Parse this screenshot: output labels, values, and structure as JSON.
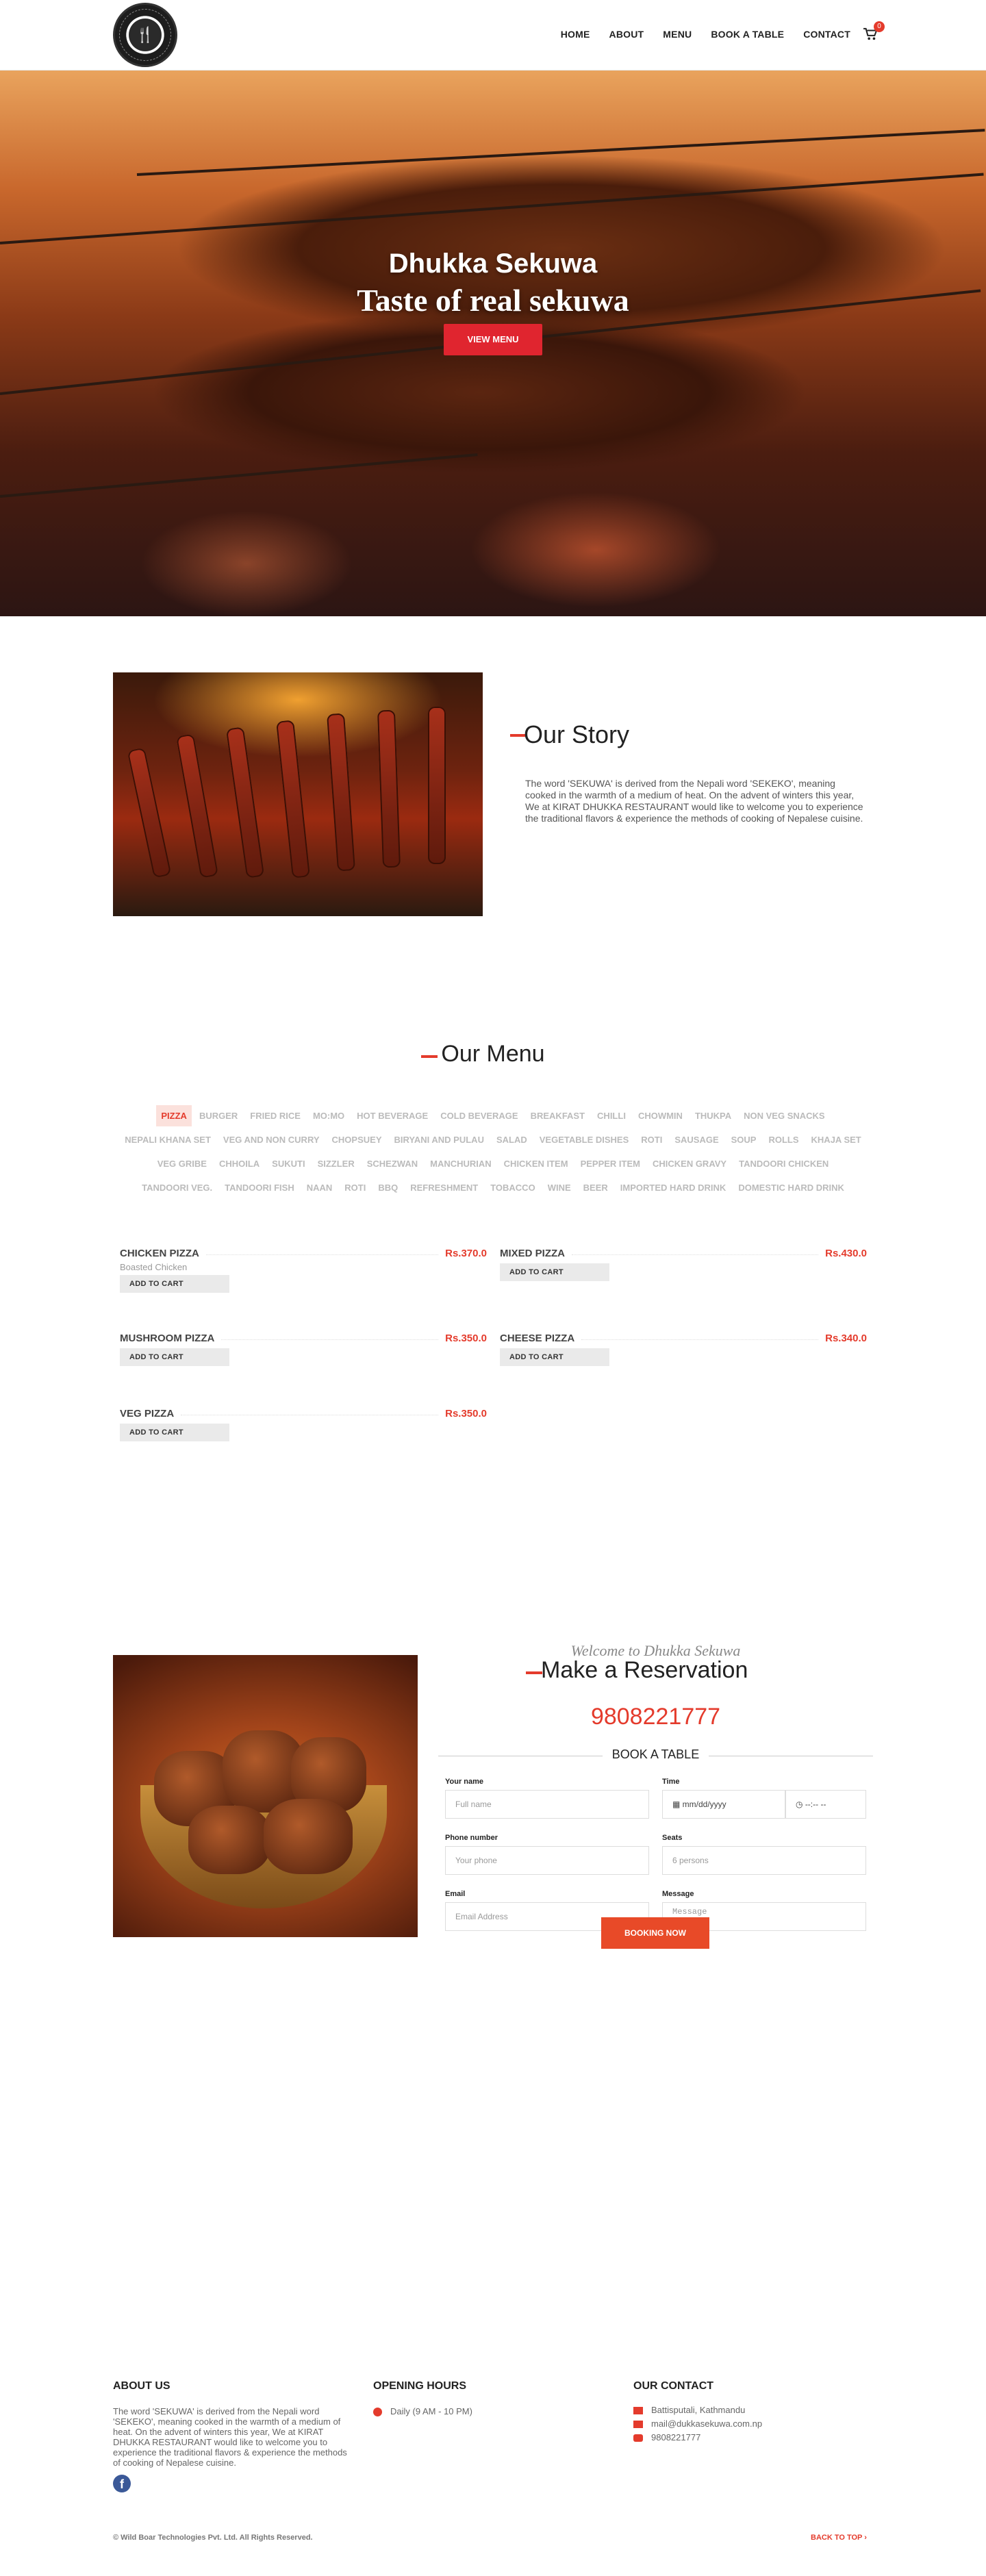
{
  "header": {
    "nav": [
      "HOME",
      "ABOUT",
      "MENU",
      "BOOK A TABLE",
      "CONTACT"
    ],
    "cart_count": "0"
  },
  "hero": {
    "subtitle": "Dhukka Sekuwa",
    "title": "Taste of real sekuwa",
    "button": "VIEW MENU"
  },
  "story": {
    "title": "Our Story",
    "text": "The word 'SEKUWA' is derived from the Nepali word 'SEKEKO', meaning cooked in the warmth of a medium of heat. On the advent of winters this year, We at KIRAT DHUKKA RESTAURANT would like to welcome you to experience the traditional flavors & experience the methods of cooking of Nepalese cuisine."
  },
  "menu": {
    "title": "Our Menu",
    "tabs": [
      "PIZZA",
      "BURGER",
      "FRIED RICE",
      "MO:MO",
      "HOT BEVERAGE",
      "COLD BEVERAGE",
      "BREAKFAST",
      "CHILLI",
      "CHOWMIN",
      "THUKPA",
      "NON VEG SNACKS",
      "NEPALI KHANA SET",
      "VEG AND NON CURRY",
      "CHOPSUEY",
      "BIRYANI AND PULAU",
      "SALAD",
      "VEGETABLE DISHES",
      "ROTI",
      "SAUSAGE",
      "SOUP",
      "ROLLS",
      "KHAJA SET",
      "VEG GRIBE",
      "CHHOILA",
      "SUKUTI",
      "SIZZLER",
      "SCHEZWAN",
      "MANCHURIAN",
      "CHICKEN ITEM",
      "PEPPER ITEM",
      "CHICKEN GRAVY",
      "TANDOORI CHICKEN",
      "TANDOORI VEG.",
      "TANDOORI FISH",
      "NAAN",
      "ROTI",
      "BBQ",
      "REFRESHMENT",
      "TOBACCO",
      "WINE",
      "BEER",
      "IMPORTED HARD DRINK",
      "DOMESTIC HARD DRINK"
    ],
    "add_label": "ADD TO CART",
    "items": [
      {
        "name": "CHICKEN PIZZA",
        "price": "Rs.370.0",
        "desc": "Boasted Chicken"
      },
      {
        "name": "MIXED PIZZA",
        "price": "Rs.430.0",
        "desc": ""
      },
      {
        "name": "MUSHROOM PIZZA",
        "price": "Rs.350.0",
        "desc": ""
      },
      {
        "name": "CHEESE PIZZA",
        "price": "Rs.340.0",
        "desc": ""
      },
      {
        "name": "VEG PIZZA",
        "price": "Rs.350.0",
        "desc": ""
      }
    ]
  },
  "reservation": {
    "welcome": "Welcome to Dhukka Sekuwa",
    "title": "Make a Reservation",
    "phone": "9808221777",
    "book_title": "BOOK A TABLE",
    "labels": {
      "name": "Your name",
      "time": "Time",
      "phone": "Phone number",
      "seats": "Seats",
      "email": "Email",
      "message": "Message"
    },
    "placeholders": {
      "name": "Full name",
      "date": "mm/dd/yyyy",
      "clock": "--:-- --",
      "phone": "Your phone",
      "seats": "6 persons",
      "email": "Email Address",
      "message": "Message"
    },
    "button": "BOOKING NOW"
  },
  "footer": {
    "about_title": "ABOUT US",
    "about_text": "The word 'SEKUWA' is derived from the Nepali word 'SEKEKO', meaning cooked in the warmth of a medium of heat. On the advent of winters this year, We at KIRAT DHUKKA RESTAURANT would like to welcome you to experience the traditional flavors & experience the methods of cooking of Nepalese cuisine.",
    "hours_title": "OPENING HOURS",
    "hours": "Daily (9 AM - 10 PM)",
    "contact_title": "OUR CONTACT",
    "address": "Battisputali, Kathmandu",
    "email": "mail@dukkasekuwa.com.np",
    "phone": "9808221777",
    "copyright": "© Wild Boar Technologies Pvt. Ltd. All Rights Reserved.",
    "back_to_top": "BACK TO TOP"
  },
  "colors": {
    "accent": "#e43b2c",
    "hero_button": "#e0252f",
    "booking_button": "#e84a28"
  }
}
